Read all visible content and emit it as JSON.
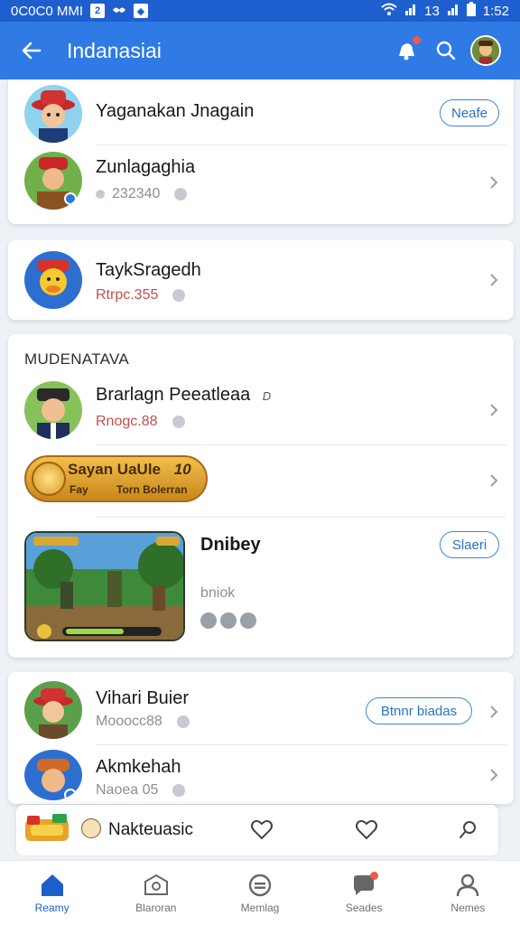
{
  "status_bar": {
    "left_text": "0C0C0 MMI",
    "box_a": "2",
    "time": "1:52",
    "right_text": "13"
  },
  "app_bar": {
    "title": "Indanasiai",
    "colors": {
      "bar": "#2f7ae5",
      "status": "#1e5fcf"
    }
  },
  "card1": {
    "rows": [
      {
        "name": "Yaganakan Jnagain",
        "button": "Neafe"
      },
      {
        "name": "Zunlagaghia",
        "sub": "232340"
      }
    ]
  },
  "card2": {
    "rows": [
      {
        "name": "TaykSragedh",
        "sub": "Rtrpc.355"
      }
    ]
  },
  "card3": {
    "section_title": "MUDENATAVA",
    "row1": {
      "name": "Brarlagn Peeatleaa",
      "mark": "D",
      "sub": "Rnogc.88"
    },
    "banner": {
      "title": "Sayan UaUle",
      "number": "10",
      "line_a": "Fay",
      "line_b": "Torn Bolerran"
    },
    "game": {
      "title": "Dnibey",
      "sub": "bniok",
      "button": "Slaeri"
    }
  },
  "card4": {
    "rows": [
      {
        "name": "Vihari Buier",
        "sub": "Mooocc88",
        "button": "Btnnr biadas"
      },
      {
        "name": "Akmkehah",
        "sub": "Naoea 05"
      }
    ]
  },
  "mini_strip": {
    "label": "Nakteuasic"
  },
  "bottom_nav": {
    "items": [
      {
        "label": "Reamy",
        "icon": "home-icon",
        "active": true
      },
      {
        "label": "Blaroran",
        "icon": "inbox-icon",
        "active": false
      },
      {
        "label": "Memlag",
        "icon": "chat-circle-icon",
        "active": false
      },
      {
        "label": "Seades",
        "icon": "message-bubble-icon",
        "active": false
      },
      {
        "label": "Nemes",
        "icon": "profile-icon",
        "active": false
      }
    ]
  }
}
